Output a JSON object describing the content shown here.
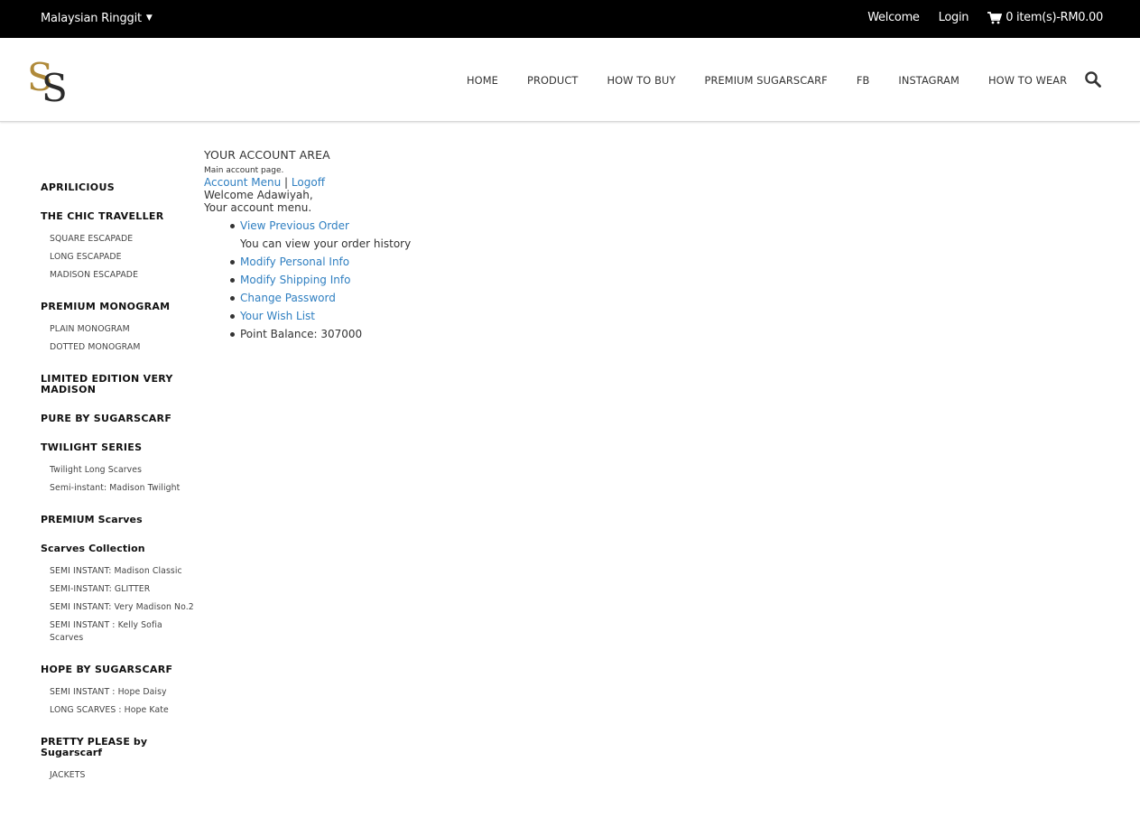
{
  "topbar": {
    "currency": "Malaysian Ringgit",
    "welcome": "Welcome",
    "login": "Login",
    "cart": "0 item(s)-RM0.00"
  },
  "header": {
    "nav": [
      "HOME",
      "PRODUCT",
      "HOW TO BUY",
      "PREMIUM SUGARSCARF",
      "FB",
      "INSTAGRAM",
      "HOW TO WEAR"
    ]
  },
  "sidebar": {
    "categories": [
      {
        "label": "APRILICIOUS",
        "subs": []
      },
      {
        "label": "THE CHIC TRAVELLER",
        "subs": [
          "SQUARE ESCAPADE",
          "LONG ESCAPADE",
          "MADISON ESCAPADE"
        ]
      },
      {
        "label": "PREMIUM MONOGRAM",
        "subs": [
          "PLAIN MONOGRAM",
          "DOTTED MONOGRAM"
        ]
      },
      {
        "label": "LIMITED EDITION VERY MADISON",
        "subs": []
      },
      {
        "label": "PURE BY SUGARSCARF",
        "subs": []
      },
      {
        "label": "TWILIGHT SERIES",
        "subs": [
          "Twilight Long Scarves",
          "Semi-instant: Madison Twilight"
        ]
      },
      {
        "label": "PREMIUM Scarves",
        "subs": []
      },
      {
        "label": "Scarves Collection",
        "subs": [
          "SEMI INSTANT: Madison Classic",
          "SEMI-INSTANT: GLITTER",
          "SEMI INSTANT: Very Madison No.2",
          "SEMI INSTANT : Kelly Sofia Scarves"
        ]
      },
      {
        "label": "HOPE BY SUGARSCARF",
        "subs": [
          "SEMI INSTANT : Hope Daisy",
          "LONG SCARVES : Hope Kate"
        ]
      },
      {
        "label": "PRETTY PLEASE by Sugarscarf",
        "subs": [
          "JACKETS"
        ]
      }
    ]
  },
  "main": {
    "heading": "YOUR ACCOUNT AREA",
    "subtitle": "Main account page.",
    "account_menu": "Account Menu",
    "separator": "|",
    "logoff": "Logoff",
    "welcome": "Welcome Adawiyah,",
    "menu_title": "Your account menu.",
    "view_previous_order": "View Previous Order",
    "order_history_note": "You can view your order history",
    "modify_personal": "Modify Personal Info",
    "modify_shipping": "Modify Shipping Info",
    "change_password": "Change Password",
    "wish_list": "Your Wish List",
    "point_balance": "Point Balance: 307000"
  },
  "colors": {
    "topbar_bg": "#000000",
    "link": "#2f7fc1",
    "logo_gold": "#b08a3a",
    "logo_dark": "#2b2b2b"
  },
  "icons": {
    "cart": "shopping-cart-icon",
    "search": "search-icon",
    "currency_caret": "caret-down-icon"
  }
}
